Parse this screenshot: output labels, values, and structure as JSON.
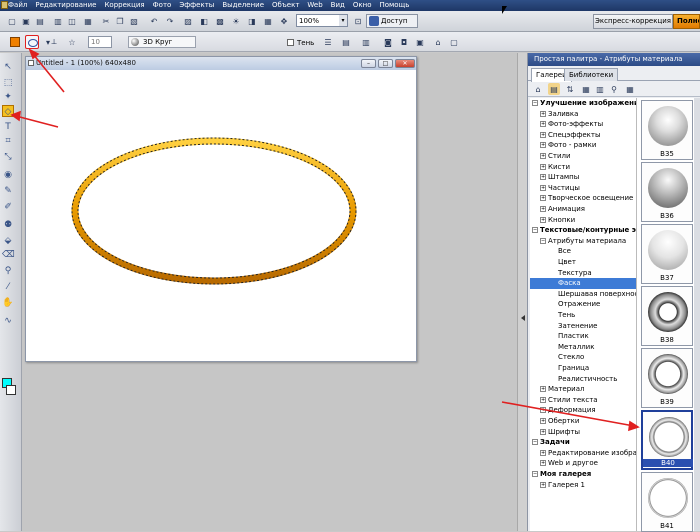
{
  "menu": {
    "items": [
      "Файл",
      "Редактирование",
      "Коррекция",
      "Фото",
      "Эффекты",
      "Выделение",
      "Объект",
      "Web",
      "Вид",
      "Окно",
      "Помощь"
    ]
  },
  "toolbar": {
    "zoom_value": "100%",
    "access_label": "Доступ",
    "express_label": "Экспресс-коррекция",
    "full_label": "Полное"
  },
  "options": {
    "size_value": "10",
    "style_value": "3D Круг",
    "shadow_label": "Тень"
  },
  "document": {
    "title": "Untitled - 1 (100%) 640x480"
  },
  "palette": {
    "title": "Простая палитра - Атрибуты материала",
    "tabs": [
      "Галереи",
      "Библиотеки"
    ],
    "tree": [
      {
        "label": "Улучшение изображения",
        "kind": "cat",
        "pm": "−",
        "indent": 0
      },
      {
        "label": "Заливка",
        "kind": "item",
        "pm": "+",
        "indent": 1
      },
      {
        "label": "Фото-эффекты",
        "kind": "item",
        "pm": "+",
        "indent": 1
      },
      {
        "label": "Спецэффекты",
        "kind": "item",
        "pm": "+",
        "indent": 1
      },
      {
        "label": "Фото - рамки",
        "kind": "item",
        "pm": "+",
        "indent": 1
      },
      {
        "label": "Стили",
        "kind": "item",
        "pm": "+",
        "indent": 1
      },
      {
        "label": "Кисти",
        "kind": "item",
        "pm": "+",
        "indent": 1
      },
      {
        "label": "Штампы",
        "kind": "item",
        "pm": "+",
        "indent": 1
      },
      {
        "label": "Частицы",
        "kind": "item",
        "pm": "+",
        "indent": 1
      },
      {
        "label": "Творческое освещение",
        "kind": "item",
        "pm": "+",
        "indent": 1
      },
      {
        "label": "Анимация",
        "kind": "item",
        "pm": "+",
        "indent": 1
      },
      {
        "label": "Кнопки",
        "kind": "item",
        "pm": "+",
        "indent": 1
      },
      {
        "label": "Текстовые/контурные эффекты",
        "kind": "cat",
        "pm": "−",
        "indent": 0
      },
      {
        "label": "Атрибуты материала",
        "kind": "item",
        "pm": "−",
        "indent": 1
      },
      {
        "label": "Все",
        "kind": "leaf",
        "pm": "",
        "indent": 2
      },
      {
        "label": "Цвет",
        "kind": "leaf",
        "pm": "",
        "indent": 2
      },
      {
        "label": "Текстура",
        "kind": "leaf",
        "pm": "",
        "indent": 2
      },
      {
        "label": "Фаска",
        "kind": "leaf",
        "pm": "",
        "indent": 2,
        "selected": true
      },
      {
        "label": "Шершавая поверхность",
        "kind": "leaf",
        "pm": "",
        "indent": 2
      },
      {
        "label": "Отражение",
        "kind": "leaf",
        "pm": "",
        "indent": 2
      },
      {
        "label": "Тень",
        "kind": "leaf",
        "pm": "",
        "indent": 2
      },
      {
        "label": "Затенение",
        "kind": "leaf",
        "pm": "",
        "indent": 2
      },
      {
        "label": "Пластик",
        "kind": "leaf",
        "pm": "",
        "indent": 2
      },
      {
        "label": "Металлик",
        "kind": "leaf",
        "pm": "",
        "indent": 2
      },
      {
        "label": "Стекло",
        "kind": "leaf",
        "pm": "",
        "indent": 2
      },
      {
        "label": "Граница",
        "kind": "leaf",
        "pm": "",
        "indent": 2
      },
      {
        "label": "Реалистичность",
        "kind": "leaf",
        "pm": "",
        "indent": 2
      },
      {
        "label": "Материал",
        "kind": "item",
        "pm": "+",
        "indent": 1
      },
      {
        "label": "Стили текста",
        "kind": "item",
        "pm": "+",
        "indent": 1
      },
      {
        "label": "Деформация",
        "kind": "item",
        "pm": "+",
        "indent": 1
      },
      {
        "label": "Обертки",
        "kind": "item",
        "pm": "+",
        "indent": 1
      },
      {
        "label": "Шрифты",
        "kind": "item",
        "pm": "+",
        "indent": 1
      },
      {
        "label": "Задачи",
        "kind": "cat",
        "pm": "−",
        "indent": 0
      },
      {
        "label": "Редактирование изображения",
        "kind": "item",
        "pm": "+",
        "indent": 1
      },
      {
        "label": "Web и другое",
        "kind": "item",
        "pm": "+",
        "indent": 1
      },
      {
        "label": "Моя галерея",
        "kind": "cat",
        "pm": "−",
        "indent": 0
      },
      {
        "label": "Галерея 1",
        "kind": "item",
        "pm": "+",
        "indent": 1
      }
    ],
    "thumbnails": [
      {
        "label": "B35",
        "style": "sphere"
      },
      {
        "label": "B36",
        "style": "sphere-dark"
      },
      {
        "label": "B37",
        "style": "sphere-light"
      },
      {
        "label": "B38",
        "style": "torus"
      },
      {
        "label": "B39",
        "style": "torus-thin"
      },
      {
        "label": "B40",
        "style": "ring",
        "selected": true
      },
      {
        "label": "B41",
        "style": "ring-flat"
      }
    ]
  },
  "colors": {
    "accent": "#f08000",
    "fg_color": "#00ffff",
    "ellipse": "#f2a000",
    "selection": "#3d7bd6",
    "annotation_arrow": "#e02020"
  }
}
